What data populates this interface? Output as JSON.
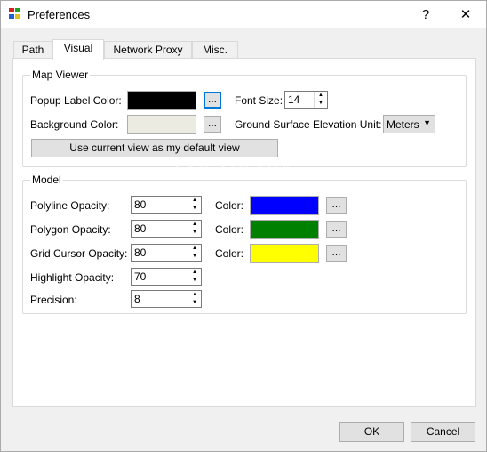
{
  "window": {
    "title": "Preferences",
    "help_glyph": "?",
    "close_glyph": "✕"
  },
  "tabs": [
    {
      "label": "Path",
      "active": false
    },
    {
      "label": "Visual",
      "active": true
    },
    {
      "label": "Network Proxy",
      "active": false
    },
    {
      "label": "Misc.",
      "active": false
    }
  ],
  "map_viewer": {
    "title": "Map Viewer",
    "popup_label_color_label": "Popup Label Color:",
    "popup_label_color": "#000000",
    "background_color_label": "Background Color:",
    "background_color": "#ebebe1",
    "browse_label": "...",
    "font_size_label": "Font Size:",
    "font_size": "14",
    "elevation_unit_label": "Ground Surface Elevation Unit:",
    "elevation_unit": "Meters",
    "default_view_button": "Use current view as my default view",
    "watermark": "SOFTPEDIA"
  },
  "model": {
    "title": "Model",
    "color_label": "Color:",
    "browse_label": "...",
    "rows": [
      {
        "label": "Polyline Opacity:",
        "value": "80",
        "color": "#0000ff"
      },
      {
        "label": "Polygon Opacity:",
        "value": "80",
        "color": "#008000"
      },
      {
        "label": "Grid Cursor Opacity:",
        "value": "80",
        "color": "#ffff00"
      },
      {
        "label": "Highlight Opacity:",
        "value": "70"
      },
      {
        "label": "Precision:",
        "value": "8"
      }
    ]
  },
  "footer": {
    "ok_label": "OK",
    "cancel_label": "Cancel"
  },
  "icons": [
    "app-icon",
    "help-icon",
    "close-icon",
    "spin-up-icon",
    "spin-down-icon",
    "dropdown-arrow-icon"
  ]
}
